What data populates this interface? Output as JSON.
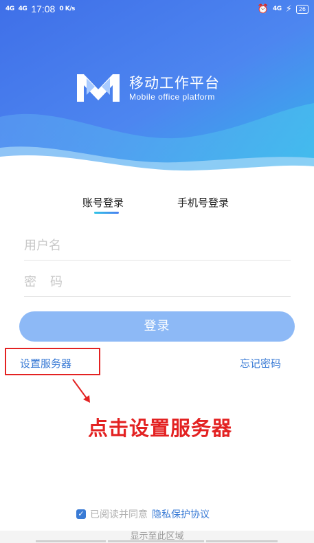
{
  "status_bar": {
    "signal_1": "4G",
    "signal_2": "4G",
    "time": "17:08",
    "speed": "0 K/s",
    "net_label": "4G",
    "battery": "26"
  },
  "brand": {
    "title": "移动工作平台",
    "subtitle": "Mobile office platform"
  },
  "tabs": [
    {
      "label": "账号登录",
      "active": true
    },
    {
      "label": "手机号登录",
      "active": false
    }
  ],
  "form": {
    "username_placeholder": "用户名",
    "password_placeholder": "密码"
  },
  "login_button": "登录",
  "links": {
    "server": "设置服务器",
    "forgot": "忘记密码"
  },
  "annotation": {
    "text": "点击设置服务器"
  },
  "agreement": {
    "checked": true,
    "prefix": "已阅读并同意",
    "link": "隐私保护协议"
  },
  "bottom_hint": "显示至此区域",
  "colors": {
    "accent": "#3a7bd5",
    "button": "#8db9f6",
    "annotation": "#e32222"
  }
}
